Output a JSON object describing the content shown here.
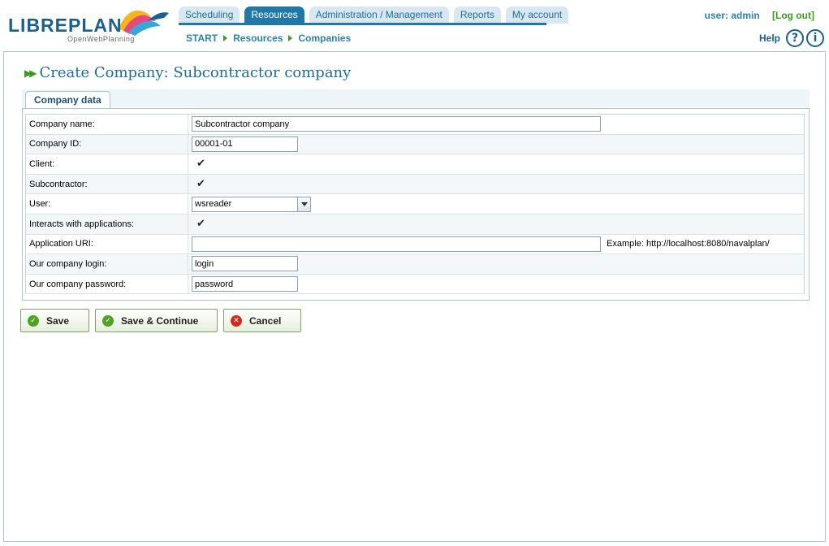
{
  "header": {
    "logo_text": "LIBREPLAN",
    "logo_subtext": "OpenWebPlanning",
    "tabs": [
      {
        "label": "Scheduling"
      },
      {
        "label": "Resources",
        "active": true
      },
      {
        "label": "Administration / Management"
      },
      {
        "label": "Reports"
      },
      {
        "label": "My account"
      }
    ],
    "user_label": "user: admin",
    "logout_label": "[Log out]",
    "breadcrumb": [
      "START",
      "Resources",
      "Companies"
    ],
    "help_label": "Help",
    "help_icon": "?",
    "info_icon": "i"
  },
  "page": {
    "title": "Create Company: Subcontractor company",
    "subtab_label": "Company data"
  },
  "form": {
    "company_name_label": "Company name:",
    "company_name_value": "Subcontractor company",
    "company_id_label": "Company ID:",
    "company_id_value": "00001-01",
    "client_label": "Client:",
    "client_checked": true,
    "subcontractor_label": "Subcontractor:",
    "subcontractor_checked": true,
    "user_label": "User:",
    "user_value": "wsreader",
    "interacts_label": "Interacts with applications:",
    "interacts_checked": true,
    "app_uri_label": "Application URI:",
    "app_uri_value": "",
    "app_uri_example": "Example: http://localhost:8080/navalplan/",
    "login_label": "Our company login:",
    "login_value": "login",
    "password_label": "Our company password:",
    "password_value": "password",
    "check_glyph": "✔"
  },
  "buttons": {
    "save_label": "Save",
    "save_continue_label": "Save & Continue",
    "cancel_label": "Cancel"
  },
  "colors": {
    "primary": "#1f78a6",
    "accent_green": "#3b9a1e",
    "cancel_red": "#d22a1f"
  }
}
